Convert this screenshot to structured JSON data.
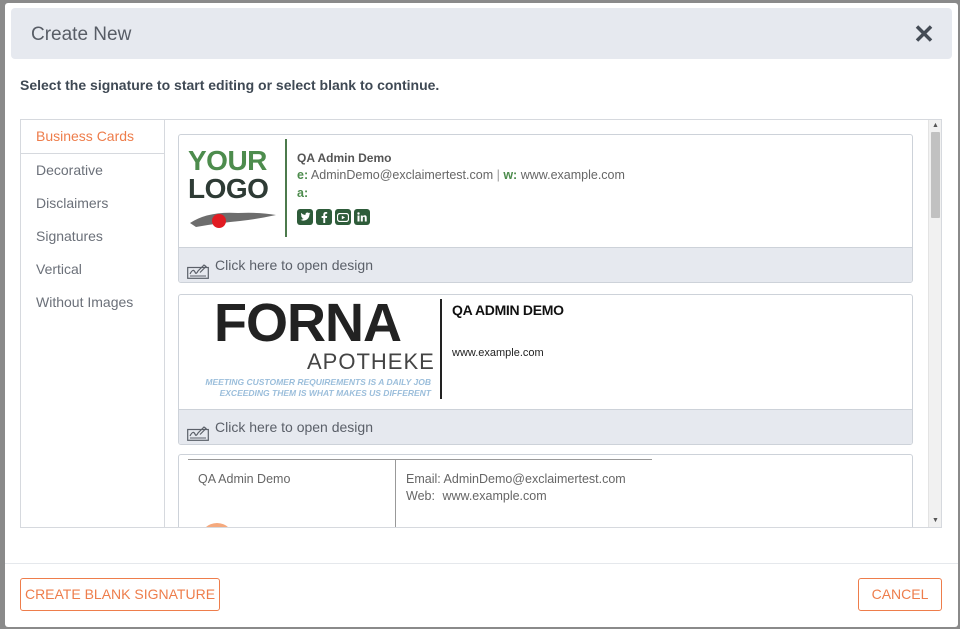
{
  "header": {
    "title": "Create New",
    "close_glyph": "✕"
  },
  "instructions": "Select the signature to start editing or select blank to continue.",
  "sidebar": {
    "items": [
      {
        "label": "Business Cards",
        "active": true
      },
      {
        "label": "Decorative",
        "active": false
      },
      {
        "label": "Disclaimers",
        "active": false
      },
      {
        "label": "Signatures",
        "active": false
      },
      {
        "label": "Vertical",
        "active": false
      },
      {
        "label": "Without Images",
        "active": false
      }
    ]
  },
  "cards": {
    "open_design_label": "Click here to open design",
    "card1": {
      "logo_line1": "YOUR",
      "logo_line2": "LOGO",
      "name": "QA Admin Demo",
      "email_prefix": "e:",
      "email": "AdminDemo@exclaimertest.com",
      "separator": "|",
      "web_prefix": "w:",
      "web": "www.example.com",
      "address_prefix": "a:",
      "social_icons": [
        "twitter-icon",
        "facebook-icon",
        "youtube-icon",
        "linkedin-icon"
      ]
    },
    "card2": {
      "logo_main": "FORNA",
      "logo_sub": "APOTHEKE",
      "tagline1": "MEETING CUSTOMER REQUIREMENTS IS A DAILY JOB",
      "tagline2": "EXCEEDING THEM IS WHAT MAKES US DIFFERENT",
      "name": "QA ADMIN DEMO",
      "web": "www.example.com"
    },
    "card3": {
      "name": "QA Admin Demo",
      "email_label": "Email:",
      "email": "AdminDemo@exclaimertest.com",
      "web_label": "Web:",
      "web": "www.example.com"
    }
  },
  "footer": {
    "create_blank_label": "CREATE BLANK SIGNATURE",
    "cancel_label": "CANCEL"
  },
  "colors": {
    "accent": "#ee7d4b",
    "header_bg": "#e6e9ef",
    "logo_green": "#4d8c4d",
    "logo_dark": "#2e3b35",
    "social_green": "#2e5c3a"
  }
}
